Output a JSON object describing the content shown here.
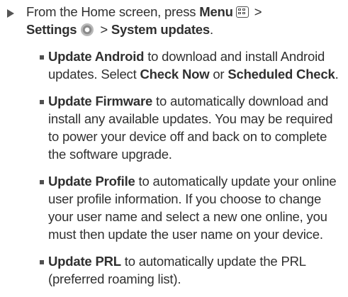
{
  "step": {
    "prefix": "From the Home screen, press ",
    "menu_label": "Menu",
    "menu_icon": "menu-grid-icon",
    "separator": " > ",
    "settings_label": "Settings",
    "settings_icon": "gear-icon",
    "separator2": " > ",
    "system_updates_label": "System updates",
    "suffix": "."
  },
  "bullets": [
    {
      "title": "Update Android",
      "text_1": " to download and install Android updates. Select ",
      "option_1": "Check Now",
      "text_2": " or ",
      "option_2": "Scheduled Check",
      "text_3": "."
    },
    {
      "title": "Update Firmware",
      "text": "  to automatically download and install any available updates. You may be required to power your device off and back on to complete the software upgrade."
    },
    {
      "title": "Update Profile",
      "text": " to automatically update your online user profile information. If you choose to change your user name and select a new one online, you must then update the user name on your device."
    },
    {
      "title": "Update PRL",
      "text": " to automatically update the PRL (preferred roaming list)."
    }
  ]
}
